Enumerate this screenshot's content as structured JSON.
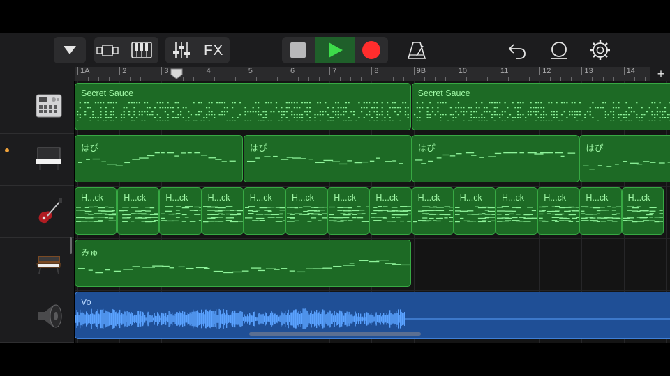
{
  "toolbar": {
    "fx_label": "FX",
    "icons": [
      "track-list-dropdown-icon",
      "tracks-view-icon",
      "keyboard-icon",
      "mixer-icon",
      "stop-icon",
      "play-icon",
      "record-icon",
      "metronome-icon",
      "undo-icon",
      "loop-icon",
      "settings-icon"
    ],
    "colors": {
      "play": "#3ddc4a",
      "record": "#ff2d2d"
    }
  },
  "ruler": {
    "bars": [
      "1A",
      "2",
      "3",
      "4",
      "5",
      "6",
      "7",
      "8",
      "9B",
      "10",
      "11",
      "12",
      "13",
      "14"
    ],
    "add_label": "+"
  },
  "tracks": [
    {
      "name": "drum-machine",
      "icon": "drum-machine-icon",
      "regions": [
        "Secret Sauce",
        "Secret Sauce"
      ]
    },
    {
      "name": "piano",
      "icon": "piano-icon",
      "regions": [
        "はぴ",
        "はぴ",
        "はぴ",
        "はぴ"
      ]
    },
    {
      "name": "guitar",
      "icon": "electric-guitar-icon",
      "regions": [
        "H...ck",
        "H...ck",
        "H...ck",
        "H...ck",
        "H...ck",
        "H...ck",
        "H...ck",
        "H...ck",
        "H...ck",
        "H...ck",
        "H...ck",
        "H...ck",
        "H...ck",
        "H...ck"
      ]
    },
    {
      "name": "synth",
      "icon": "synthesizer-icon",
      "regions": [
        "みゅ"
      ]
    },
    {
      "name": "vocal",
      "icon": "speaker-icon",
      "regions": [
        "Vo"
      ]
    }
  ],
  "colors": {
    "midi_region": "#1d6a25",
    "audio_region": "#1f4f96",
    "selected_track": "#f0a23a"
  }
}
